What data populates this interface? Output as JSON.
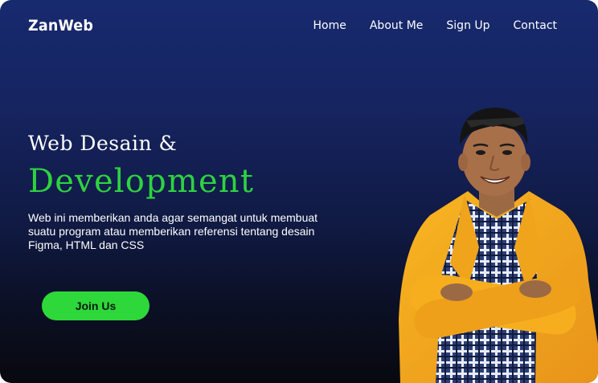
{
  "header": {
    "logo": "ZanWeb",
    "nav": [
      "Home",
      "About Me",
      "Sign Up",
      "Contact"
    ]
  },
  "hero": {
    "title_line1": "Web Desain &",
    "title_line2": "Development",
    "description": "Web ini memberikan anda agar semangat untuk membuat suatu program atau memberikan referensi tentang desain Figma, HTML dan CSS",
    "cta_label": "Join Us"
  },
  "colors": {
    "accent_green": "#2ed83a",
    "bg_top": "#172a6e",
    "bg_bottom": "#08090f",
    "jacket_yellow": "#f5a91c"
  },
  "images": {
    "hero_photo": "person-portrait"
  }
}
